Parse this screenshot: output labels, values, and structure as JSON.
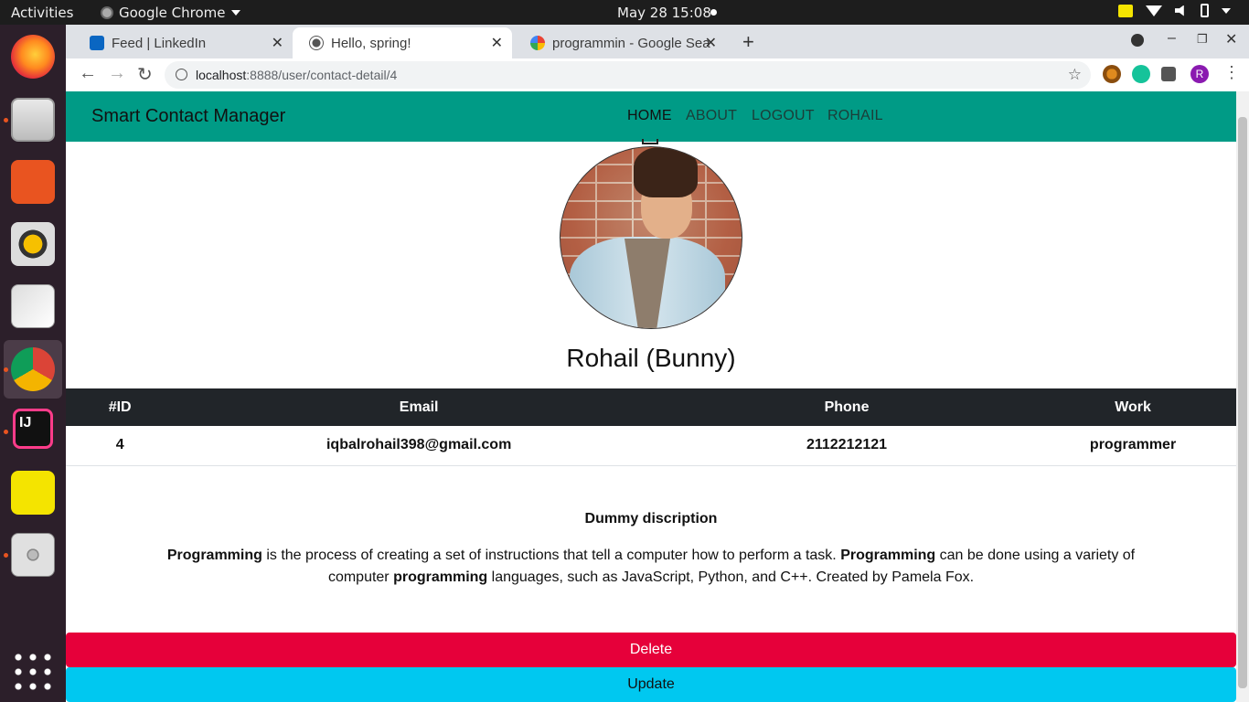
{
  "os": {
    "activities": "Activities",
    "app_name": "Google Chrome",
    "clock": "May 28  15:08",
    "tray_icons": [
      "notes-icon",
      "wifi-icon",
      "volume-icon",
      "battery-icon",
      "caret-down-icon"
    ]
  },
  "dock": [
    "firefox-icon",
    "files-icon",
    "app-store-icon",
    "rhythmbox-icon",
    "database-tool-icon",
    "chrome-icon",
    "intellij-icon",
    "notes-icon",
    "disc-icon",
    "app-grid-icon"
  ],
  "browser": {
    "tabs": [
      {
        "title": "Feed | LinkedIn",
        "favicon": "linkedin-icon"
      },
      {
        "title": "Hello, spring!",
        "favicon": "globe-icon"
      },
      {
        "title": "programmin - Google Sea",
        "favicon": "google-icon"
      }
    ],
    "url_host": "localhost",
    "url_path": ":8888/user/contact-detail/4",
    "profile_initial": "R"
  },
  "navbar": {
    "brand": "Smart Contact Manager",
    "links": [
      "HOME",
      "ABOUT",
      "LOGOUT",
      "ROHAIL"
    ]
  },
  "contact": {
    "name": "Rohail (Bunny)",
    "columns": [
      "#ID",
      "Email",
      "Phone",
      "Work"
    ],
    "row": {
      "id": "4",
      "email": "iqbalrohail398@gmail.com",
      "phone": "2112212121",
      "work": "programmer"
    }
  },
  "description": {
    "title": "Dummy discription",
    "parts": [
      {
        "bold": true,
        "text": "Programming"
      },
      {
        "bold": false,
        "text": " is the process of creating a set of instructions that tell a computer how to perform a task. "
      },
      {
        "bold": true,
        "text": "Programming"
      },
      {
        "bold": false,
        "text": " can be done using a variety of computer "
      },
      {
        "bold": true,
        "text": "programming"
      },
      {
        "bold": false,
        "text": " languages, such as JavaScript, Python, and C++. Created by Pamela Fox."
      }
    ]
  },
  "actions": {
    "delete": "Delete",
    "update": "Update"
  },
  "colors": {
    "navbar": "#009b86",
    "delete": "#e6003a",
    "update": "#00c8f0",
    "table_header": "#212529"
  }
}
